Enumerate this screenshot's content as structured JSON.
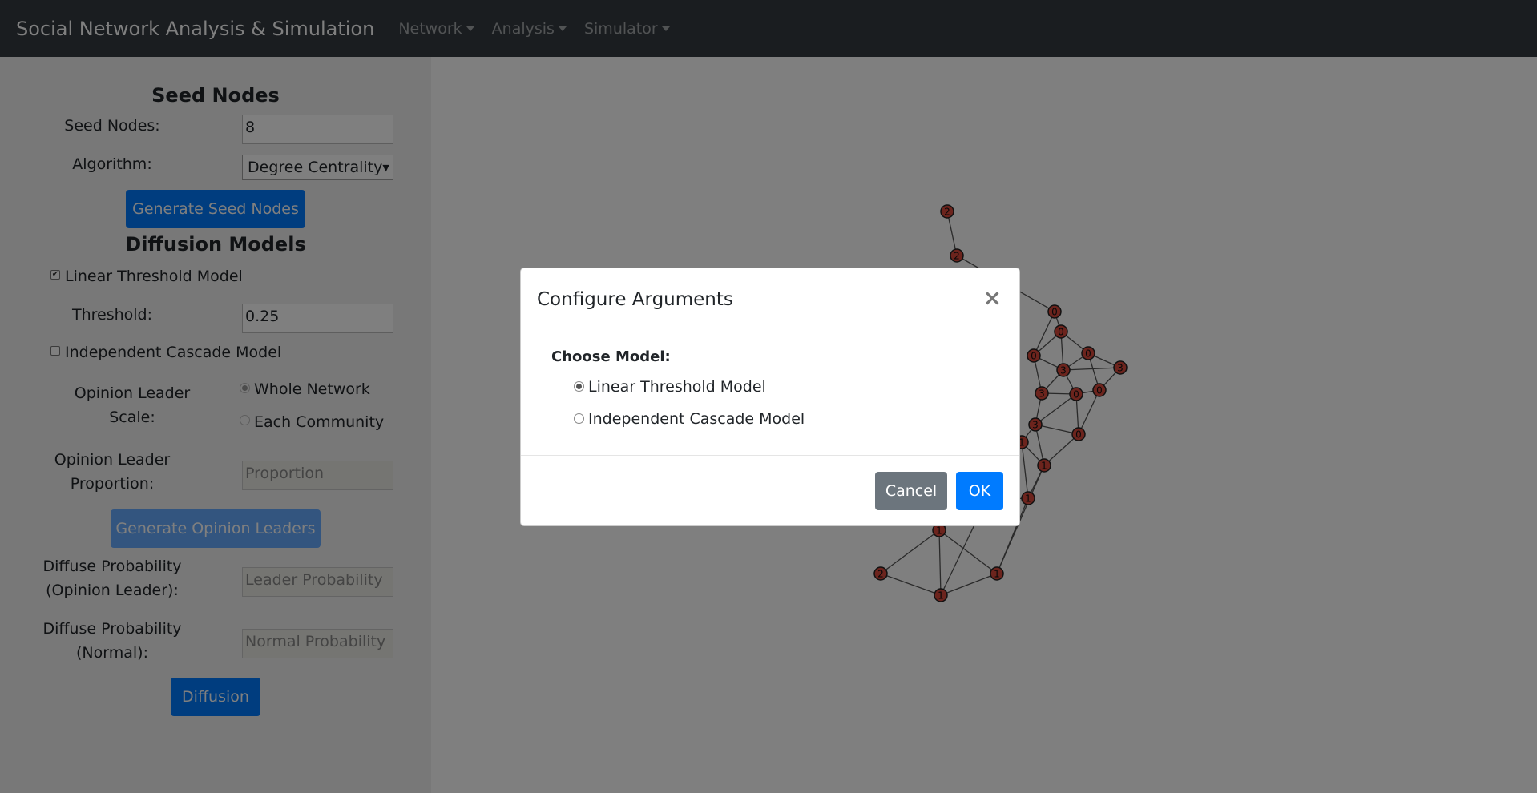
{
  "navbar": {
    "brand": "Social Network Analysis & Simulation",
    "menus": [
      "Network",
      "Analysis",
      "Simulator"
    ]
  },
  "sidebar": {
    "seed_title": "Seed Nodes",
    "seed_nodes_label": "Seed Nodes:",
    "seed_nodes_value": "8",
    "algorithm_label": "Algorithm:",
    "algorithm_value": "Degree Centrality",
    "generate_seed_button": "Generate Seed Nodes",
    "diffusion_title": "Diffusion Models",
    "linear_threshold_label": "Linear Threshold Model",
    "linear_threshold_checked": true,
    "threshold_label": "Threshold:",
    "threshold_value": "0.25",
    "independent_cascade_label": "Independent Cascade Model",
    "independent_cascade_checked": false,
    "opinion_scale_label_1": "Opinion Leader",
    "opinion_scale_label_2": "Scale:",
    "scale_whole": "Whole Network",
    "scale_each": "Each Community",
    "opinion_prop_label_1": "Opinion Leader",
    "opinion_prop_label_2": "Proportion:",
    "proportion_placeholder": "Proportion",
    "generate_leaders_button": "Generate Opinion Leaders",
    "prob_leader_label_1": "Diffuse Probability",
    "prob_leader_label_2": "(Opinion Leader):",
    "leader_prob_placeholder": "Leader Probability",
    "prob_normal_label_1": "Diffuse Probability",
    "prob_normal_label_2": "(Normal):",
    "normal_prob_placeholder": "Normal Probability",
    "diffusion_button": "Diffusion"
  },
  "graph": {
    "node_fill": "#d9483b",
    "edge_color": "#555555",
    "nodes": [
      {
        "id": "a",
        "label": "2"
      },
      {
        "id": "b",
        "label": "2"
      },
      {
        "id": "c",
        "label": "0"
      },
      {
        "id": "d",
        "label": "0"
      },
      {
        "id": "e",
        "label": "0"
      },
      {
        "id": "f",
        "label": "0"
      },
      {
        "id": "g",
        "label": "3"
      },
      {
        "id": "h",
        "label": "3"
      },
      {
        "id": "i",
        "label": "3"
      },
      {
        "id": "j",
        "label": "0"
      },
      {
        "id": "k",
        "label": "0"
      },
      {
        "id": "l",
        "label": "3"
      },
      {
        "id": "m",
        "label": "0"
      },
      {
        "id": "n",
        "label": "1"
      },
      {
        "id": "o",
        "label": "1"
      },
      {
        "id": "p",
        "label": "1"
      },
      {
        "id": "q",
        "label": "1"
      },
      {
        "id": "r",
        "label": "1"
      },
      {
        "id": "s",
        "label": "1"
      },
      {
        "id": "t",
        "label": "2"
      },
      {
        "id": "u",
        "label": "1"
      }
    ]
  },
  "modal": {
    "title": "Configure Arguments",
    "close_glyph": "×",
    "choose_label": "Choose Model:",
    "options": [
      "Linear Threshold Model",
      "Independent Cascade Model"
    ],
    "selected_option": "Linear Threshold Model",
    "cancel_label": "Cancel",
    "ok_label": "OK",
    "cancel_color": "#6c757d",
    "ok_color": "#007bff"
  }
}
